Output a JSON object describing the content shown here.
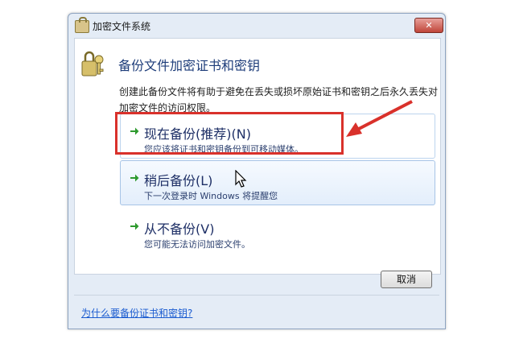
{
  "window": {
    "title": "加密文件系统",
    "close_label": "✕"
  },
  "header": {
    "heading": "备份文件加密证书和密钥",
    "description": "创建此备份文件将有助于避免在丢失或损坏原始证书和密钥之后永久丢失对加密文件的访问权限。"
  },
  "options": [
    {
      "title": "现在备份(推荐)(N)",
      "subtitle": "您应该将证书和密钥备份到可移动媒体。"
    },
    {
      "title": "稍后备份(L)",
      "subtitle": "下一次登录时 Windows 将提醒您"
    },
    {
      "title": "从不备份(V)",
      "subtitle": "您可能无法访问加密文件。"
    }
  ],
  "buttons": {
    "cancel_label": "取消"
  },
  "footer": {
    "help_link": "为什么要备份证书和密钥?"
  },
  "colors": {
    "annotation": "#d9312b",
    "arrow_green": "#2e9a2e",
    "heading_blue": "#1e3d7a"
  },
  "icons": [
    "key-lock-icon",
    "green-arrow-icon",
    "close-icon",
    "mouse-cursor-icon"
  ]
}
